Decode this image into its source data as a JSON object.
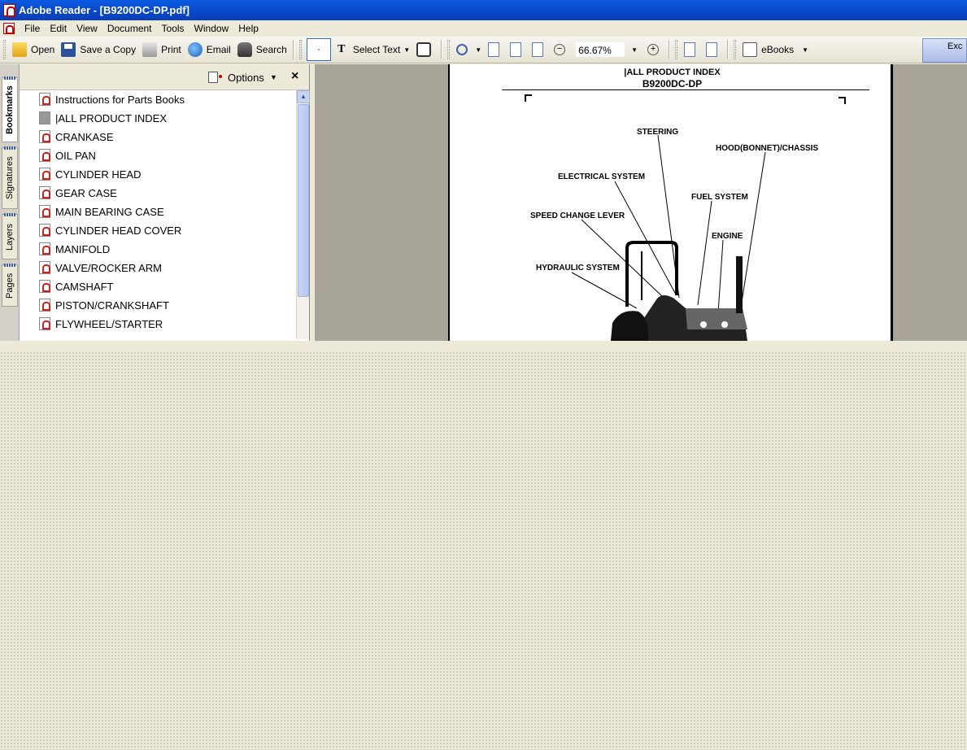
{
  "window": {
    "title": "Adobe Reader - [B9200DC-DP.pdf]"
  },
  "menu": [
    "File",
    "Edit",
    "View",
    "Document",
    "Tools",
    "Window",
    "Help"
  ],
  "toolbar": {
    "open": "Open",
    "save_copy": "Save a Copy",
    "print": "Print",
    "email": "Email",
    "search": "Search",
    "select_text": "Select Text",
    "zoom": "66.67%",
    "ebooks": "eBooks",
    "excel": "Exc"
  },
  "sidetabs": [
    "Bookmarks",
    "Signatures",
    "Layers",
    "Pages"
  ],
  "panel": {
    "options": "Options",
    "close": "×"
  },
  "bookmarks": [
    {
      "label": "Instructions for Parts Books",
      "icon": "pdf-page-icon"
    },
    {
      "label": "|ALL PRODUCT INDEX",
      "icon": "gray-page-icon"
    },
    {
      "label": "CRANKASE",
      "icon": "pdf-page-icon"
    },
    {
      "label": "OIL PAN",
      "icon": "pdf-page-icon"
    },
    {
      "label": "CYLINDER HEAD",
      "icon": "pdf-page-icon"
    },
    {
      "label": "GEAR CASE",
      "icon": "pdf-page-icon"
    },
    {
      "label": "MAIN BEARING CASE",
      "icon": "pdf-page-icon"
    },
    {
      "label": "CYLINDER HEAD COVER",
      "icon": "pdf-page-icon"
    },
    {
      "label": "MANIFOLD",
      "icon": "pdf-page-icon"
    },
    {
      "label": "VALVE/ROCKER ARM",
      "icon": "pdf-page-icon"
    },
    {
      "label": "CAMSHAFT",
      "icon": "pdf-page-icon"
    },
    {
      "label": "PISTON/CRANKSHAFT",
      "icon": "pdf-page-icon"
    },
    {
      "label": "FLYWHEEL/STARTER",
      "icon": "pdf-page-icon"
    }
  ],
  "document": {
    "title": "|ALL PRODUCT INDEX",
    "model": "B9200DC-DP",
    "labels": {
      "steering": "STEERING",
      "hood": "HOOD(BONNET)/CHASSIS",
      "electrical": "ELECTRICAL SYSTEM",
      "fuel": "FUEL SYSTEM",
      "speed": "SPEED CHANGE LEVER",
      "engine": "ENGINE",
      "hydraulic": "HYDRAULIC SYSTEM"
    }
  }
}
